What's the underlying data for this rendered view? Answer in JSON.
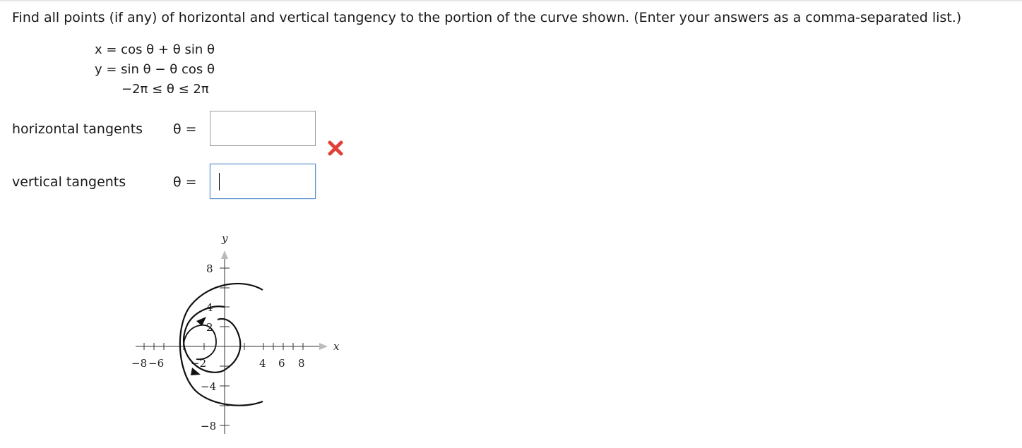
{
  "question": {
    "text": "Find all points (if any) of horizontal and vertical tangency to the portion of the curve shown. (Enter your answers as a comma-separated list.)"
  },
  "equations": {
    "x_line": "x  =  cos θ + θ sin θ",
    "y_line": "y  =  sin θ − θ cos θ",
    "domain": "−2π ≤ θ ≤ 2π"
  },
  "horizontal": {
    "label": "horizontal tangents",
    "theta": "θ  =",
    "value": "",
    "status": "incorrect"
  },
  "vertical": {
    "label": "vertical tangents",
    "theta": "θ  =",
    "value": ""
  },
  "graph": {
    "x_axis_label": "x",
    "y_axis_label": "y",
    "x_ticks": [
      "−8",
      "−6",
      "−2",
      "4",
      "6",
      "8"
    ],
    "y_ticks": [
      "8",
      "4",
      "2",
      "−4",
      "−8"
    ]
  },
  "colors": {
    "wrong": "#e0403a",
    "focus_border": "#5b8fc8"
  }
}
